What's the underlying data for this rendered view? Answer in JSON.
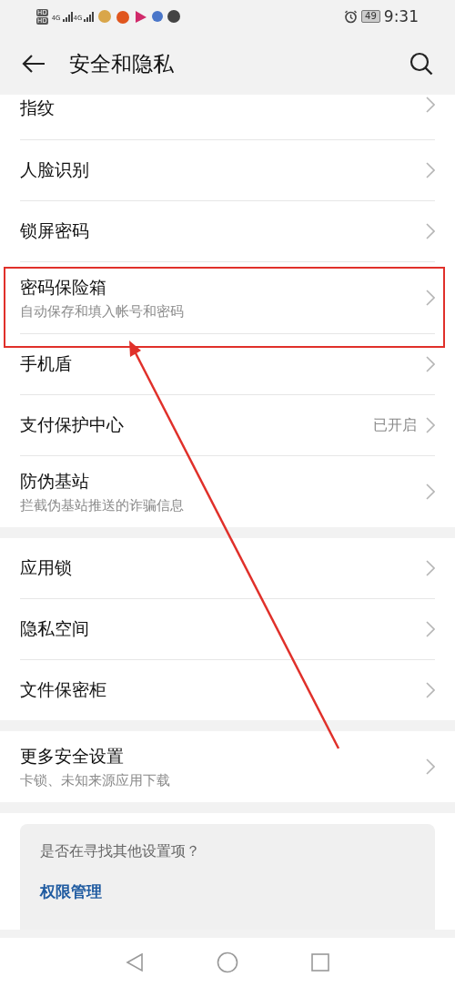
{
  "status_bar": {
    "sim_badges": [
      "HD",
      "HD"
    ],
    "network": [
      "4G",
      "4G"
    ],
    "battery": "49",
    "time": "9:31"
  },
  "header": {
    "title": "安全和隐私"
  },
  "groups": [
    {
      "items": [
        {
          "title": "指纹",
          "cut_top": true
        },
        {
          "title": "人脸识别"
        },
        {
          "title": "锁屏密码"
        },
        {
          "title": "密码保险箱",
          "subtitle": "自动保存和填入帐号和密码",
          "highlighted": true
        },
        {
          "title": "手机盾"
        },
        {
          "title": "支付保护中心",
          "value": "已开启"
        },
        {
          "title": "防伪基站",
          "subtitle": "拦截伪基站推送的诈骗信息"
        }
      ]
    },
    {
      "items": [
        {
          "title": "应用锁"
        },
        {
          "title": "隐私空间"
        },
        {
          "title": "文件保密柜"
        }
      ]
    },
    {
      "items": [
        {
          "title": "更多安全设置",
          "subtitle": "卡锁、未知来源应用下载"
        }
      ]
    }
  ],
  "suggestions": {
    "question": "是否在寻找其他设置项？",
    "links": [
      "权限管理"
    ]
  },
  "annotation": {
    "kind": "arrow"
  }
}
